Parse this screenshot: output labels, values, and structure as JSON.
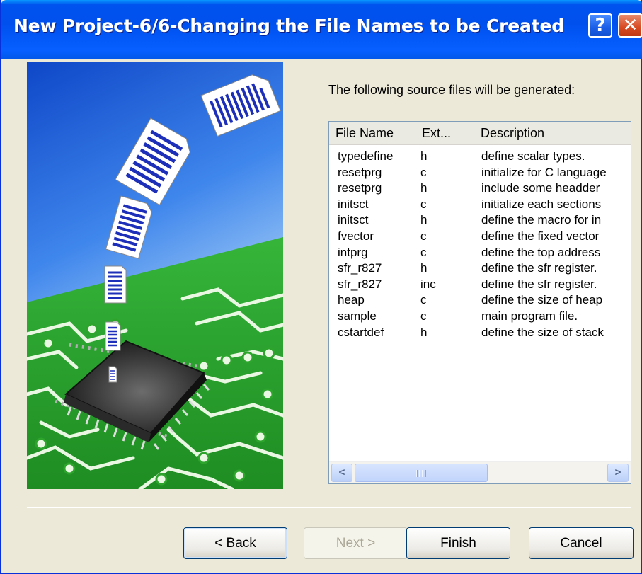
{
  "window": {
    "title": "New Project-6/6-Changing the File Names to be Created",
    "help_button": "?",
    "close_button": "✕"
  },
  "intro_text": "The following source files will be generated:",
  "file_list": {
    "columns": [
      "File Name",
      "Ext...",
      "Description"
    ],
    "rows": [
      {
        "name": "typedefine",
        "ext": "h",
        "desc": "define scalar types."
      },
      {
        "name": "resetprg",
        "ext": "c",
        "desc": "initialize for C language"
      },
      {
        "name": "resetprg",
        "ext": "h",
        "desc": "include some headder"
      },
      {
        "name": "initsct",
        "ext": "c",
        "desc": "initialize each sections"
      },
      {
        "name": "initsct",
        "ext": "h",
        "desc": "define the macro for in"
      },
      {
        "name": "fvector",
        "ext": "c",
        "desc": "define the fixed vector"
      },
      {
        "name": "intprg",
        "ext": "c",
        "desc": "define the top address"
      },
      {
        "name": "sfr_r827",
        "ext": "h",
        "desc": "define the sfr register."
      },
      {
        "name": "sfr_r827",
        "ext": "inc",
        "desc": "define the sfr register."
      },
      {
        "name": "heap",
        "ext": "c",
        "desc": "define the size of heap"
      },
      {
        "name": "sample",
        "ext": "c",
        "desc": "main program file."
      },
      {
        "name": "cstartdef",
        "ext": "h",
        "desc": "define the size of stack"
      }
    ],
    "scroll_left": "<",
    "scroll_right": ">"
  },
  "buttons": {
    "back": "< Back",
    "next": "Next >",
    "finish": "Finish",
    "cancel": "Cancel"
  },
  "colors": {
    "title_bar": "#0054E3",
    "dialog_bg": "#ECE9D8",
    "picture_sky": "#1D5BD8",
    "picture_board": "#2DA52D"
  }
}
